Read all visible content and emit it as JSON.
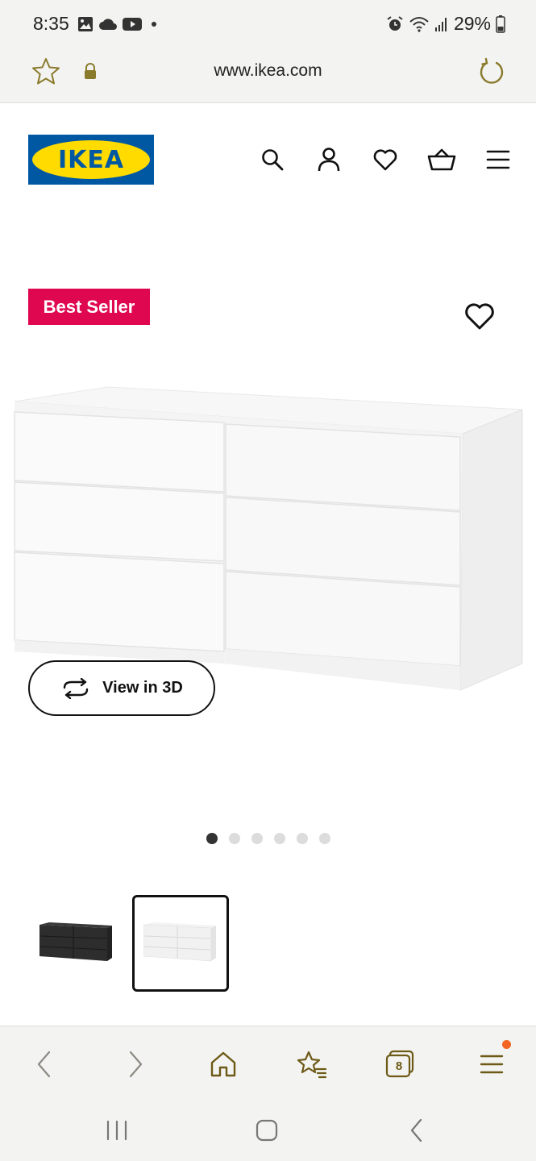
{
  "status_bar": {
    "time": "8:35",
    "battery": "29%",
    "icons": [
      "gallery-icon",
      "cloud-icon",
      "youtube-icon",
      "dot-icon",
      "alarm-icon",
      "wifi-icon",
      "signal-icon",
      "battery-icon"
    ]
  },
  "browser": {
    "url": "www.ikea.com",
    "tab_count": "8"
  },
  "site": {
    "logo_text": "IKEA",
    "brand_blue": "#0058a3",
    "brand_yellow": "#ffdb00"
  },
  "product": {
    "badge": "Best Seller",
    "badge_color": "#e00751",
    "view3d_label": "View in 3D",
    "image_count": 6,
    "active_image": 1,
    "thumbnails": [
      "black-dresser",
      "white-dresser"
    ],
    "selected_thumbnail": 2
  }
}
